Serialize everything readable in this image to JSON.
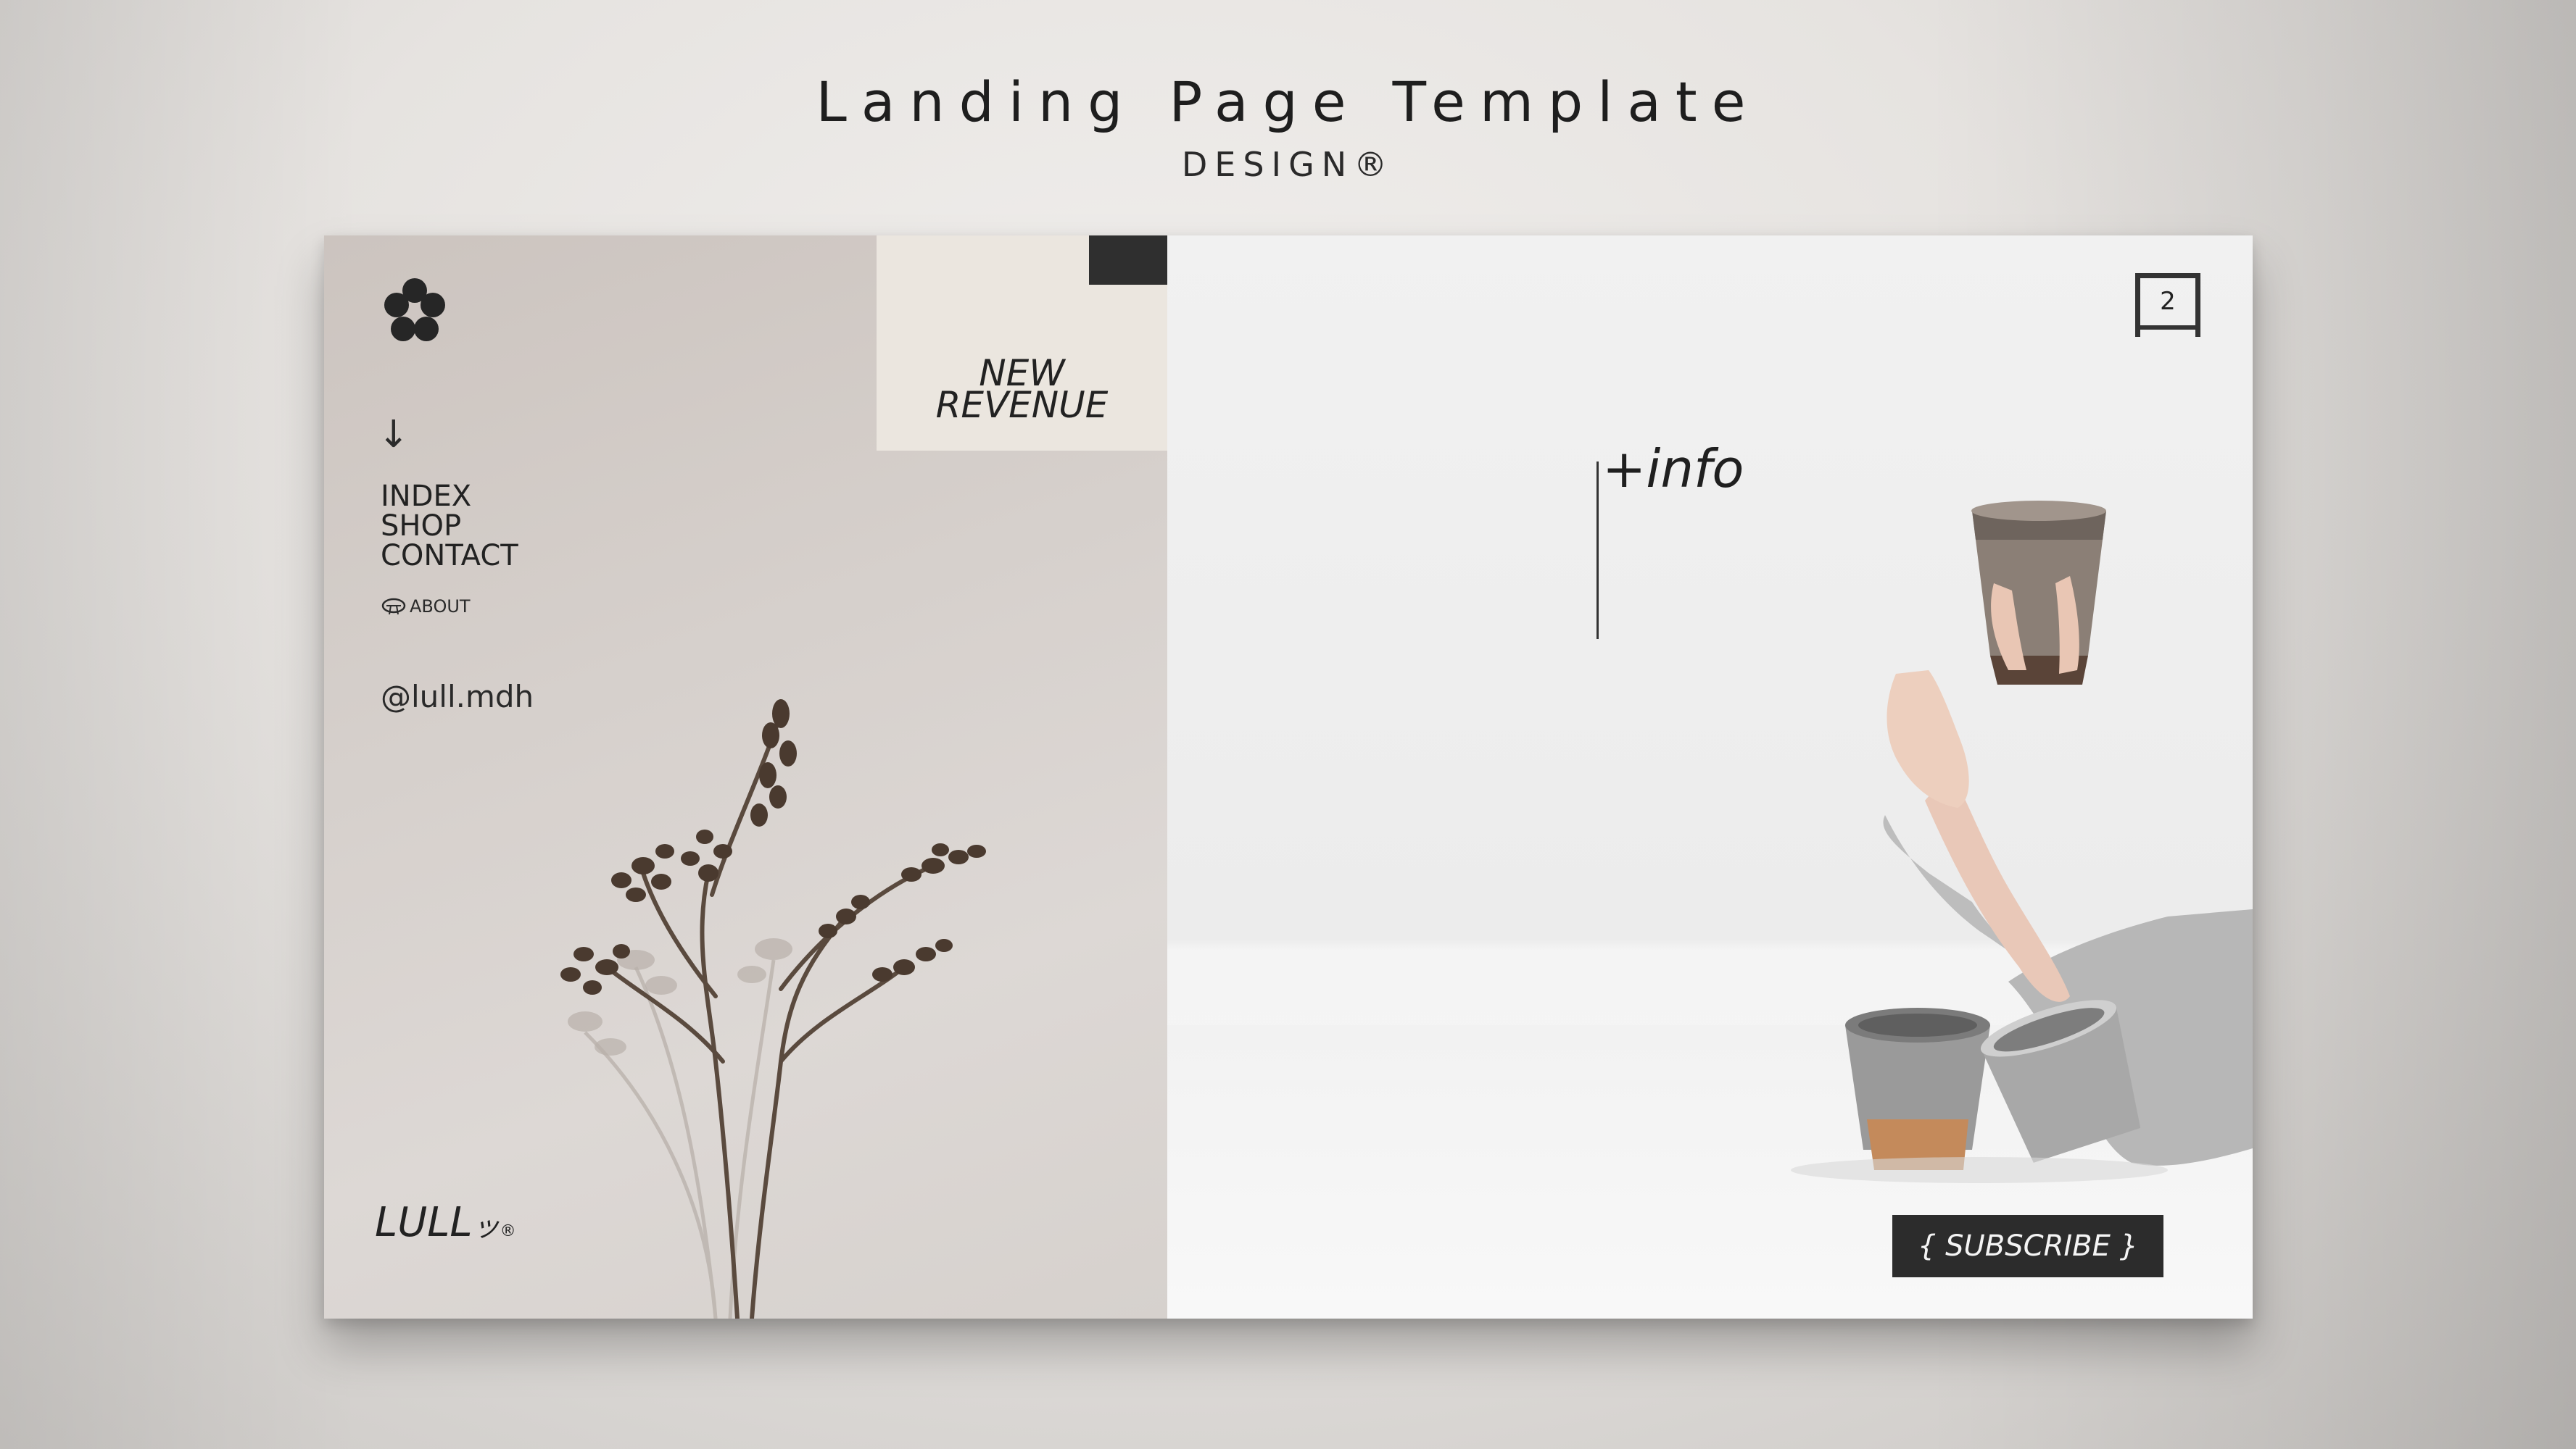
{
  "header": {
    "title": "Landing Page Template",
    "subtitle": "DESIGN®"
  },
  "left_panel": {
    "logo_icon": "flower-icon",
    "arrow": "↓",
    "nav": [
      "INDEX",
      "SHOP",
      "CONTACT"
    ],
    "about": "ABOUT",
    "handle": "@lull.mdh",
    "brand": {
      "name": "LULL",
      "mark": "ッ",
      "reg": "®"
    }
  },
  "promo": {
    "line1": "NEW",
    "line2": "REVENUE"
  },
  "right_panel": {
    "page_number": "2",
    "info": "+info",
    "subscribe": "{ SUBSCRIBE }"
  },
  "colors": {
    "dark": "#2c2c2c",
    "left_bg": "#d6d0cc",
    "promo_bg": "#ebe6df",
    "right_bg": "#f1f1f1"
  }
}
